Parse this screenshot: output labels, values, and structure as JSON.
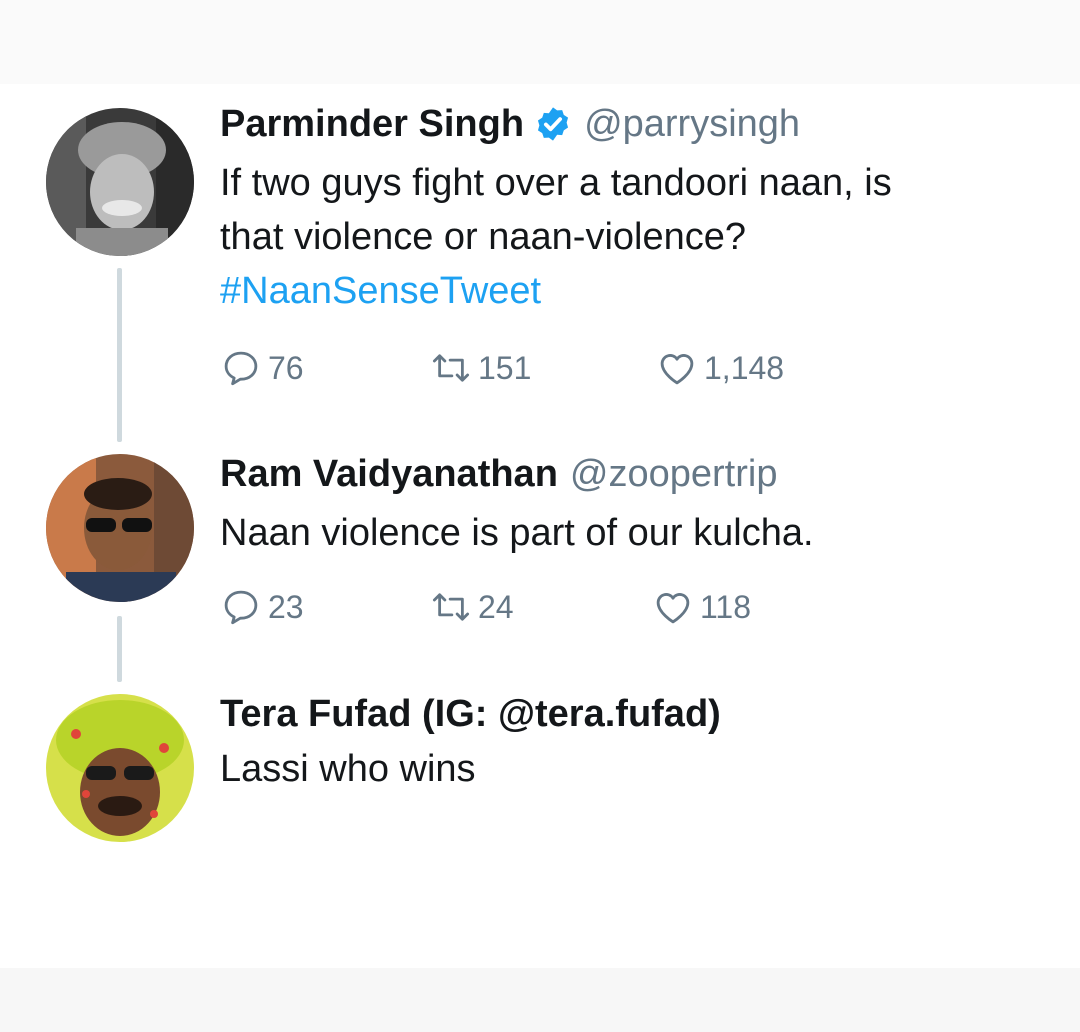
{
  "tweets": [
    {
      "name": "Parminder Singh",
      "handle": "@parrysingh",
      "verified": true,
      "text_line1": "If two guys fight over a tandoori naan, is",
      "text_line2": "that violence or naan-violence?",
      "hashtag": "#NaanSenseTweet",
      "replies": "76",
      "retweets": "151",
      "likes": "1,148"
    },
    {
      "name": "Ram Vaidyanathan",
      "handle": "@zoopertrip",
      "verified": false,
      "text_line1": "Naan violence is part of our kulcha.",
      "replies": "23",
      "retweets": "24",
      "likes": "118"
    },
    {
      "name": "Tera Fufad (IG: @tera.fufad)",
      "text_line1": "Lassi who wins"
    }
  ],
  "colors": {
    "link": "#1da1f2",
    "secondary_text": "#657786",
    "thread_line": "#cfd9de",
    "verified_badge": "#1da1f2"
  },
  "icons": [
    "reply-icon",
    "retweet-icon",
    "like-icon",
    "verified-badge-icon"
  ]
}
